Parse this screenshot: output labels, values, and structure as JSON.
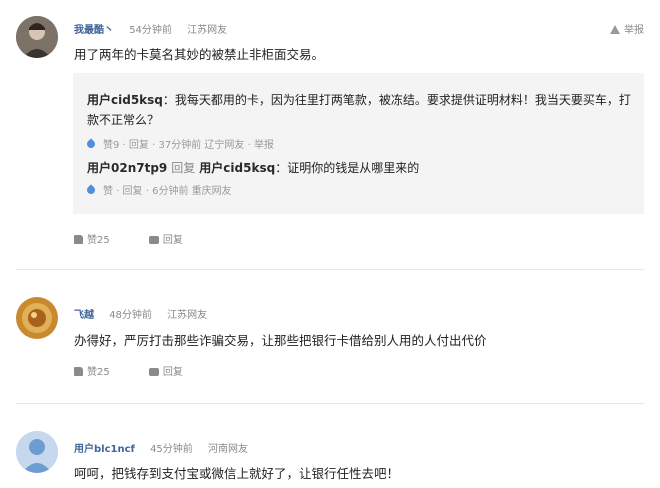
{
  "comments": [
    {
      "username": "我最酷丶",
      "time": "54分钟前",
      "location": "江苏网友",
      "report": "举报",
      "text": "用了两年的卡莫名其妙的被禁止非柜面交易。",
      "replies": [
        {
          "user": "用户cid5ksq",
          "text_line1": "：我每天都用的卡，因为往里打两笔款，被冻结。要求提供证明材料！我当天要买车，打",
          "text_line2": "款不正常么？",
          "likes": "赞9",
          "reply_label": "回复",
          "time": "37分钟前",
          "location": "辽宁网友",
          "report": "举报"
        },
        {
          "user": "用户02n7tp9",
          "reply_word": "回复",
          "target_user": "用户cid5ksq",
          "text": "：证明你的钱是从哪里来的",
          "likes": "赞",
          "reply_label": "回复",
          "time": "6分钟前",
          "location": "重庆网友"
        }
      ],
      "likes": "赞25",
      "reply_label": "回复"
    },
    {
      "username": "飞越",
      "time": "48分钟前",
      "location": "江苏网友",
      "text": "办得好，严厉打击那些诈骗交易，让那些把银行卡借给别人用的人付出代价",
      "likes": "赞25",
      "reply_label": "回复"
    },
    {
      "username": "用户blc1ncf",
      "time": "45分钟前",
      "location": "河南网友",
      "text": "呵呵，把钱存到支付宝或微信上就好了，让银行任性去吧！"
    }
  ],
  "colors": {
    "username": "#406599",
    "meta": "#8a8a8a",
    "reply_bg": "#f4f4f4",
    "like_drop": "#4f8fde"
  },
  "icons": [
    "warning-icon",
    "like-drop-icon",
    "thumb-up-icon",
    "comment-icon",
    "avatar-icon"
  ]
}
